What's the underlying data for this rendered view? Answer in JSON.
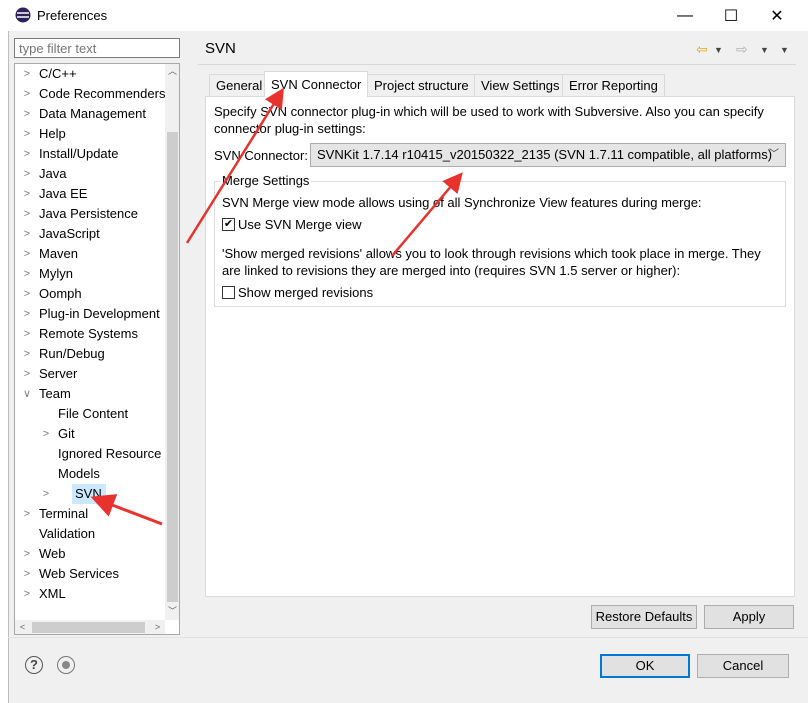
{
  "window": {
    "title": "Preferences",
    "controls": {
      "minimize": "—",
      "maximize": "☐",
      "close": "✕"
    }
  },
  "filter": {
    "placeholder": "type filter text"
  },
  "tree": {
    "items": [
      {
        "label": "C/C++",
        "level": 0,
        "state": "collapsed"
      },
      {
        "label": "Code Recommenders",
        "level": 0,
        "state": "collapsed"
      },
      {
        "label": "Data Management",
        "level": 0,
        "state": "collapsed"
      },
      {
        "label": "Help",
        "level": 0,
        "state": "collapsed"
      },
      {
        "label": "Install/Update",
        "level": 0,
        "state": "collapsed"
      },
      {
        "label": "Java",
        "level": 0,
        "state": "collapsed"
      },
      {
        "label": "Java EE",
        "level": 0,
        "state": "collapsed"
      },
      {
        "label": "Java Persistence",
        "level": 0,
        "state": "collapsed"
      },
      {
        "label": "JavaScript",
        "level": 0,
        "state": "collapsed"
      },
      {
        "label": "Maven",
        "level": 0,
        "state": "collapsed"
      },
      {
        "label": "Mylyn",
        "level": 0,
        "state": "collapsed"
      },
      {
        "label": "Oomph",
        "level": 0,
        "state": "collapsed"
      },
      {
        "label": "Plug-in Development",
        "level": 0,
        "state": "collapsed"
      },
      {
        "label": "Remote Systems",
        "level": 0,
        "state": "collapsed"
      },
      {
        "label": "Run/Debug",
        "level": 0,
        "state": "collapsed"
      },
      {
        "label": "Server",
        "level": 0,
        "state": "collapsed"
      },
      {
        "label": "Team",
        "level": 0,
        "state": "expanded"
      },
      {
        "label": "File Content",
        "level": 1,
        "state": "leaf"
      },
      {
        "label": "Git",
        "level": 1,
        "state": "collapsed"
      },
      {
        "label": "Ignored Resource",
        "level": 1,
        "state": "leaf"
      },
      {
        "label": "Models",
        "level": 1,
        "state": "leaf"
      },
      {
        "label": "SVN",
        "level": 1,
        "state": "collapsed",
        "selected": true
      },
      {
        "label": "Terminal",
        "level": 0,
        "state": "collapsed"
      },
      {
        "label": "Validation",
        "level": 0,
        "state": "leaf"
      },
      {
        "label": "Web",
        "level": 0,
        "state": "collapsed"
      },
      {
        "label": "Web Services",
        "level": 0,
        "state": "collapsed"
      },
      {
        "label": "XML",
        "level": 0,
        "state": "collapsed"
      }
    ]
  },
  "page": {
    "title": "SVN",
    "tabs": [
      "General",
      "SVN Connector",
      "Project structure",
      "View Settings",
      "Error Reporting"
    ],
    "selected_tab": "SVN Connector",
    "intro_line1": "Specify SVN connector plug-in which will be used to work with Subversive. Also you can specify",
    "intro_line2": "connector plug-in settings:",
    "connector_label": "SVN Connector:",
    "connector_value": "SVNKit 1.7.14 r10415_v20150322_2135 (SVN 1.7.11 compatible, all platforms)",
    "merge_group": {
      "legend": "Merge Settings",
      "desc": "SVN Merge view mode allows using of all Synchronize View features during merge:",
      "use_merge_view": {
        "label": "Use SVN Merge view",
        "checked": true
      },
      "desc2_line1": "'Show merged revisions' allows you to look through revisions which took place in merge. They",
      "desc2_line2": "are linked to revisions they are merged into (requires SVN 1.5 server or higher):",
      "show_merged": {
        "label": "Show merged revisions",
        "checked": false
      }
    },
    "restore_defaults": "Restore Defaults",
    "apply": "Apply"
  },
  "footer": {
    "help_icon": "?",
    "ok": "OK",
    "cancel": "Cancel"
  },
  "colors": {
    "accent": "#0078d7",
    "selection": "#cce8ff",
    "annotation": "#e8322d",
    "nav_back": "#e8a317"
  }
}
